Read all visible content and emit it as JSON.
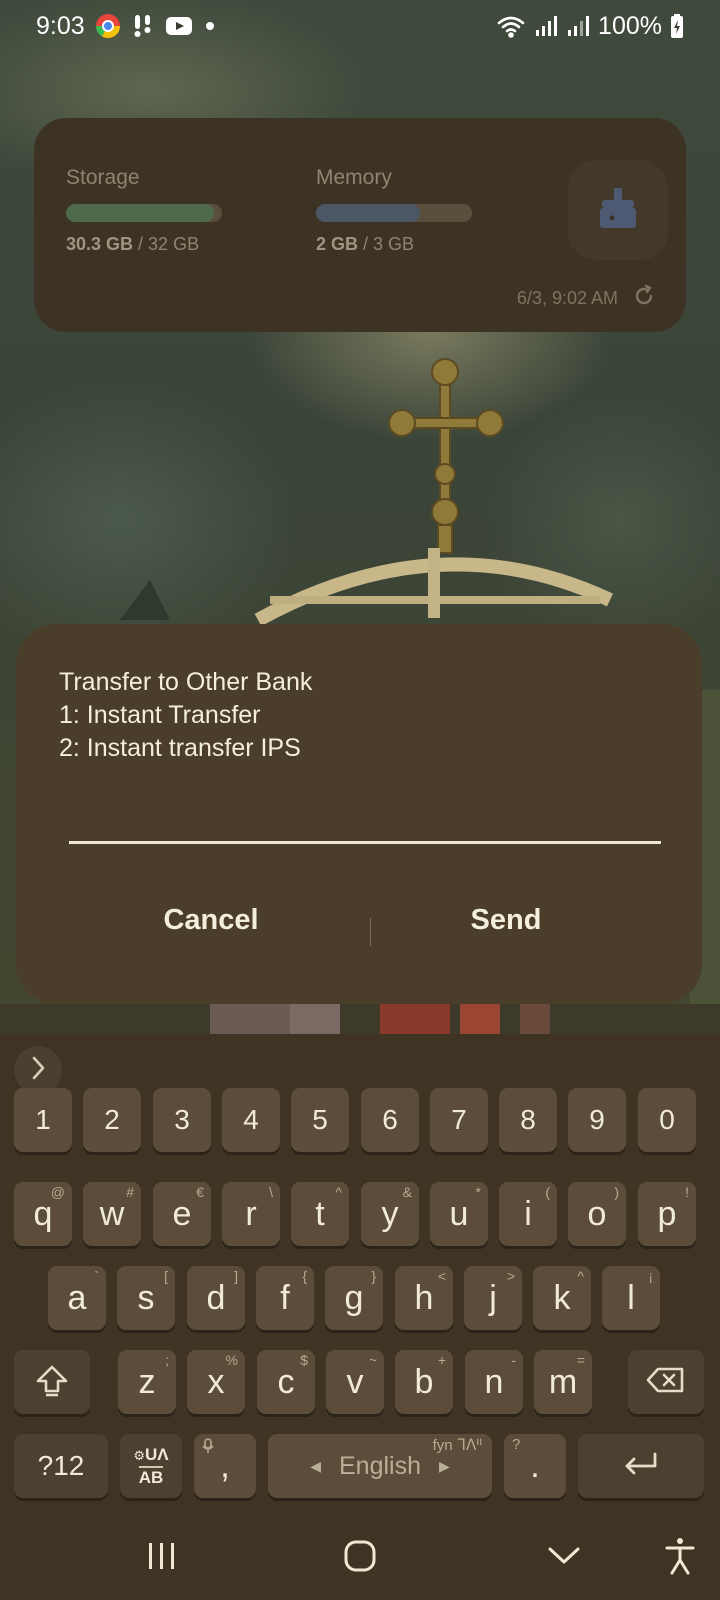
{
  "status_bar": {
    "time": "9:03",
    "battery": "100%",
    "left_icons": [
      "chrome-icon",
      "usb-debug-icon",
      "youtube-icon",
      "dot-icon"
    ],
    "right_icons": [
      "wifi-icon",
      "signal-icon",
      "signal-icon",
      "battery-charging-icon"
    ]
  },
  "widget": {
    "storage": {
      "label": "Storage",
      "used": "30.3 GB",
      "total": " / 32 GB",
      "fraction": 0.947,
      "color": "#4f6a4a"
    },
    "memory": {
      "label": "Memory",
      "used": "2 GB",
      "total": " / 3 GB",
      "fraction": 0.667,
      "color": "#4c5766"
    },
    "updated": "6/3, 9:02 AM",
    "clean_icon": "broom-icon",
    "refresh_icon": "refresh-icon"
  },
  "dialog": {
    "message_lines": [
      "Transfer to Other Bank",
      "1: Instant Transfer",
      "2: Instant transfer IPS"
    ],
    "input_value": "",
    "cancel_label": "Cancel",
    "send_label": "Send"
  },
  "keyboard": {
    "expand_icon": "chevron-right-icon",
    "number_row": [
      "1",
      "2",
      "3",
      "4",
      "5",
      "6",
      "7",
      "8",
      "9",
      "0"
    ],
    "row1": [
      {
        "key": "q",
        "sub": "@"
      },
      {
        "key": "w",
        "sub": "#"
      },
      {
        "key": "e",
        "sub": "€"
      },
      {
        "key": "r",
        "sub": "\\"
      },
      {
        "key": "t",
        "sub": "^"
      },
      {
        "key": "y",
        "sub": "&"
      },
      {
        "key": "u",
        "sub": "*"
      },
      {
        "key": "i",
        "sub": "("
      },
      {
        "key": "o",
        "sub": ")"
      },
      {
        "key": "p",
        "sub": "!"
      }
    ],
    "row2": [
      {
        "key": "a",
        "sub": "`"
      },
      {
        "key": "s",
        "sub": "["
      },
      {
        "key": "d",
        "sub": "]"
      },
      {
        "key": "f",
        "sub": "{"
      },
      {
        "key": "g",
        "sub": "}"
      },
      {
        "key": "h",
        "sub": "<"
      },
      {
        "key": "j",
        "sub": ">"
      },
      {
        "key": "k",
        "sub": "^"
      },
      {
        "key": "l",
        "sub": "¡"
      }
    ],
    "row3": [
      {
        "key": "z",
        "sub": ";"
      },
      {
        "key": "x",
        "sub": "%"
      },
      {
        "key": "c",
        "sub": "$"
      },
      {
        "key": "v",
        "sub": "~"
      },
      {
        "key": "b",
        "sub": "+"
      },
      {
        "key": "n",
        "sub": "-"
      },
      {
        "key": "m",
        "sub": "="
      }
    ],
    "symbols_key": "?12",
    "lang_key_top": "UΛ",
    "lang_key_bottom": "AB",
    "comma_key": ",",
    "space_label": "English",
    "space_sub": "fyn ᒣᐱᐦ",
    "period_key": ".",
    "period_sub": "?",
    "shift_icon": "shift-icon",
    "backspace_icon": "backspace-icon",
    "enter_icon": "enter-icon",
    "mic_icon": "mic-icon"
  },
  "nav_bar": {
    "icons": [
      "recent-apps-icon",
      "home-icon",
      "hide-keyboard-icon",
      "accessibility-icon"
    ]
  }
}
